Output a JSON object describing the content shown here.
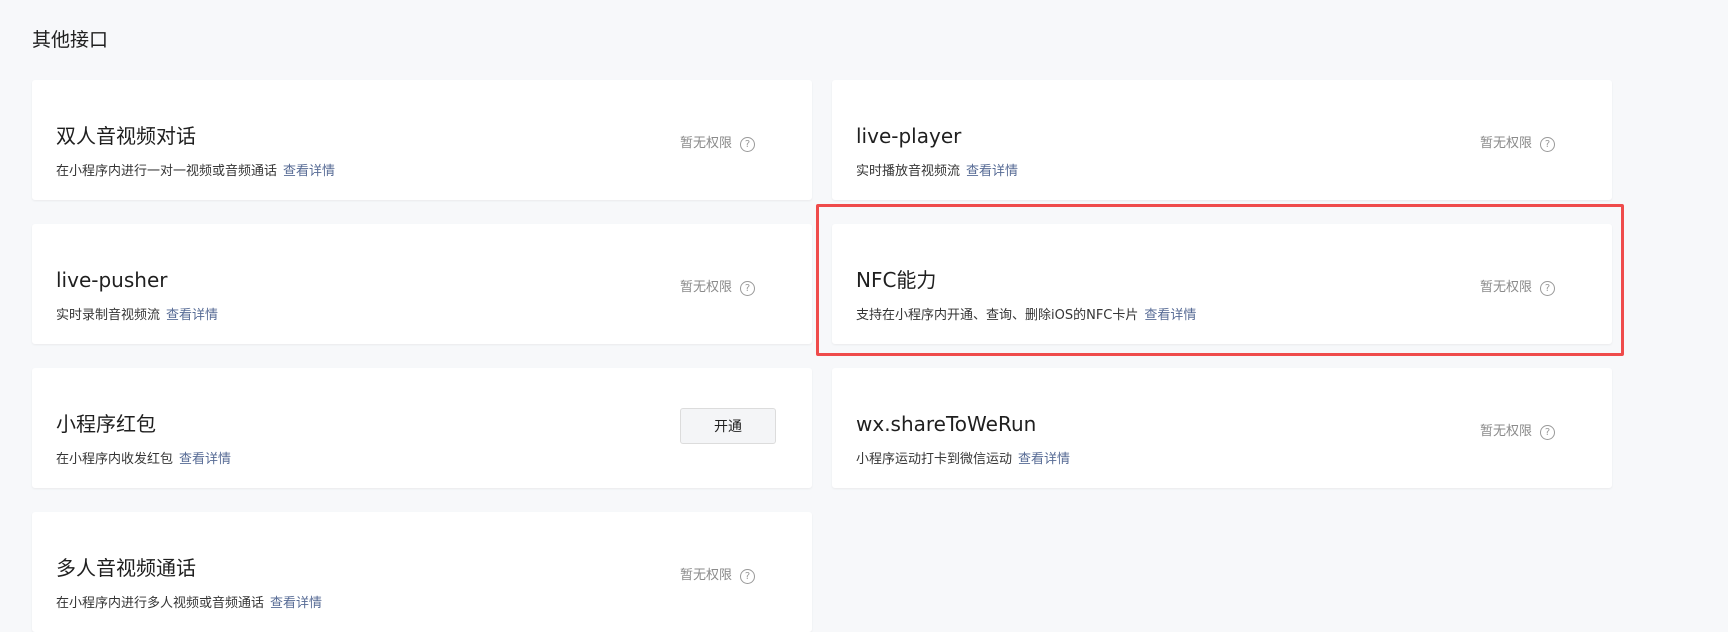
{
  "section": {
    "title": "其他接口"
  },
  "common": {
    "detail_link": "查看详情",
    "no_permission": "暂无权限",
    "help_glyph": "?"
  },
  "cards": [
    {
      "title": "双人音视频对话",
      "desc": "在小程序内进行一对一视频或音频通话",
      "status": "no_permission"
    },
    {
      "title": "live-player",
      "desc": "实时播放音视频流",
      "status": "no_permission"
    },
    {
      "title": "live-pusher",
      "desc": "实时录制音视频流",
      "status": "no_permission"
    },
    {
      "title": "NFC能力",
      "desc": "支持在小程序内开通、查询、删除iOS的NFC卡片",
      "status": "no_permission"
    },
    {
      "title": "小程序红包",
      "desc": "在小程序内收发红包",
      "status": "enable",
      "button_label": "开通"
    },
    {
      "title": "wx.shareToWeRun",
      "desc": "小程序运动打卡到微信运动",
      "status": "no_permission"
    },
    {
      "title": "多人音视频通话",
      "desc": "在小程序内进行多人视频或音频通话",
      "status": "no_permission"
    }
  ],
  "colors": {
    "link": "#576b95",
    "highlight": "#ef4b4b",
    "background": "#f7f8fa"
  }
}
